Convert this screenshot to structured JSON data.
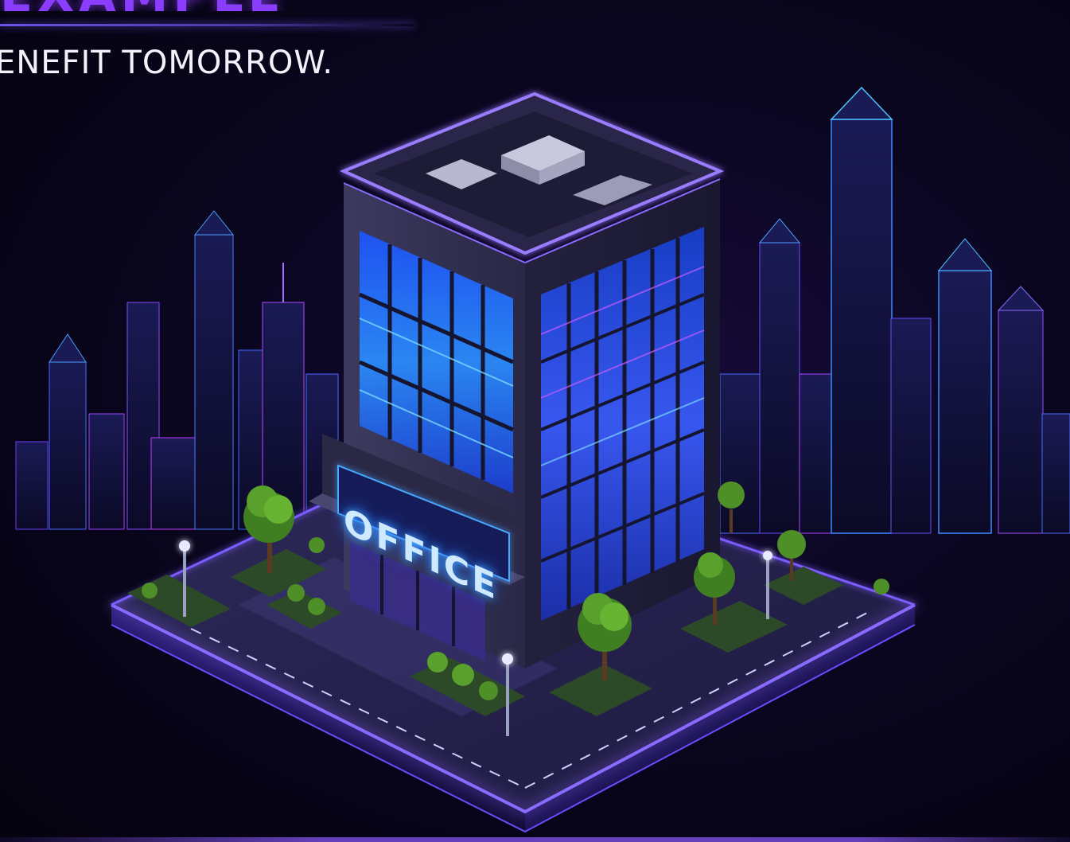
{
  "headline": {
    "partial_title": "EXAMPLE",
    "tagline": "ENEFIT TOMORROW."
  },
  "building": {
    "sign_text": "OFFICE"
  },
  "colors": {
    "background": "#07041a",
    "neon_violet": "#7b5cff",
    "neon_blue": "#3d6bff",
    "window_glow": "#2f7dff",
    "magenta": "#c23dff",
    "tree": "#5aa02c"
  }
}
